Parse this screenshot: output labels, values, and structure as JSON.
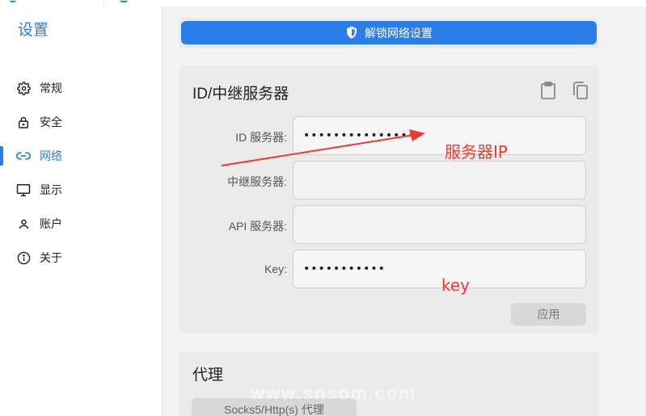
{
  "sidebar": {
    "title": "设置",
    "items": [
      {
        "label": "常规",
        "icon": "gear-icon"
      },
      {
        "label": "安全",
        "icon": "lock-icon"
      },
      {
        "label": "网络",
        "icon": "link-icon"
      },
      {
        "label": "显示",
        "icon": "monitor-icon"
      },
      {
        "label": "账户",
        "icon": "user-icon"
      },
      {
        "label": "关于",
        "icon": "info-icon"
      }
    ],
    "active_index": 2
  },
  "main": {
    "unlock_label": "解锁网络设置",
    "server_card": {
      "title": "ID/中继服务器",
      "fields": [
        {
          "label": "ID 服务器:",
          "value": "•••••••••••••••"
        },
        {
          "label": "中继服务器:",
          "value": ""
        },
        {
          "label": "API 服务器:",
          "value": ""
        },
        {
          "label": "Key:",
          "value": "•••••••••••"
        }
      ],
      "apply_label": "应用"
    },
    "proxy_card": {
      "title": "代理",
      "button_label": "Socks5/Http(s) 代理"
    }
  },
  "annotations": {
    "server_ip": "服务器IP",
    "key": "key",
    "color": "#f03a2e"
  },
  "watermark": "www.snsom.com",
  "colors": {
    "accent": "#2b7de9",
    "panel": "#ebebeb",
    "background": "#f3f3f3"
  }
}
